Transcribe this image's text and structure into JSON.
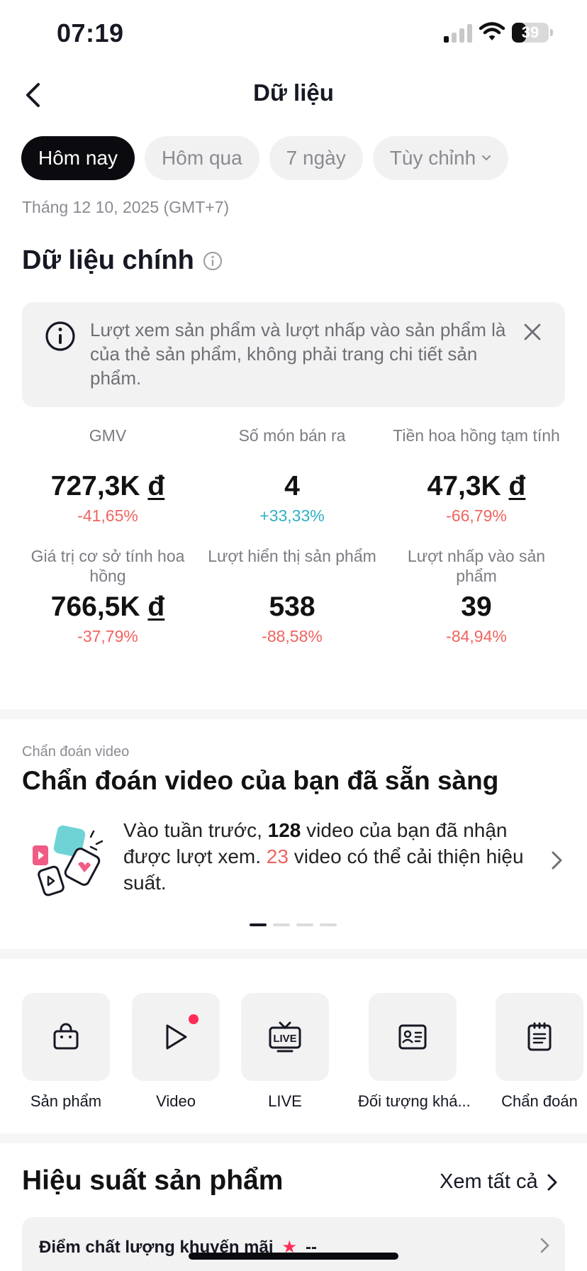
{
  "status_bar": {
    "time": "07:19",
    "battery": "39",
    "battery_level": 0.39
  },
  "header": {
    "title": "Dữ liệu"
  },
  "tabs": [
    {
      "label": "Hôm nay",
      "active": true
    },
    {
      "label": "Hôm qua",
      "active": false
    },
    {
      "label": "7 ngày",
      "active": false
    },
    {
      "label": "Tùy chỉnh",
      "active": false
    }
  ],
  "date": "Tháng 12 10, 2025 (GMT+7)",
  "main_data": {
    "title": "Dữ liệu chính",
    "notice": "Lượt xem sản phẩm và lượt nhấp vào sản phẩm là của thẻ sản phẩm, không phải trang chi tiết sản phẩm.",
    "currency": "đ",
    "metrics": [
      {
        "label": "GMV",
        "value": "727,3K",
        "currency": true,
        "change": "-41,65%",
        "trend": "down"
      },
      {
        "label": "Số món bán ra",
        "value": "4",
        "currency": false,
        "change": "+33,33%",
        "trend": "up"
      },
      {
        "label": "Tiền hoa hồng tạm tính",
        "value": "47,3K",
        "currency": true,
        "change": "-66,79%",
        "trend": "down"
      },
      {
        "label": "Giá trị cơ sở tính hoa hồng",
        "value": "766,5K",
        "currency": true,
        "change": "-37,79%",
        "trend": "down"
      },
      {
        "label": "Lượt hiển thị sản phẩm",
        "value": "538",
        "currency": false,
        "change": "-88,58%",
        "trend": "down"
      },
      {
        "label": "Lượt nhấp vào sản phẩm",
        "value": "39",
        "currency": false,
        "change": "-84,94%",
        "trend": "down"
      }
    ]
  },
  "video_diagnosis": {
    "kicker": "Chẩn đoán video",
    "title": "Chẩn đoán video của bạn đã sẵn sàng",
    "text_1": "Vào tuần trước, ",
    "count_total": "128",
    "text_2": " video của bạn đã nhận được lượt xem. ",
    "count_improve": "23",
    "text_3": " video có thể cải thiện hiệu suất.",
    "pages": 4,
    "active_page": 0
  },
  "shortcuts": [
    {
      "label": "Sản phẩm",
      "icon": "shopping-bag-icon"
    },
    {
      "label": "Video",
      "icon": "play-icon",
      "badge": true
    },
    {
      "label": "LIVE",
      "icon": "live-tv-icon"
    },
    {
      "label": "Đối tượng khá...",
      "icon": "id-card-icon"
    },
    {
      "label": "Chẩn đoán",
      "icon": "clipboard-icon"
    }
  ],
  "product_performance": {
    "title": "Hiệu suất sản phẩm",
    "see_all": "Xem tất cả",
    "quality_label": "Điểm chất lượng khuyến mãi",
    "quality_value": "--"
  },
  "colors": {
    "accent": "#fe2c55",
    "negative": "#f0645f",
    "positive": "#2fb1c5"
  }
}
